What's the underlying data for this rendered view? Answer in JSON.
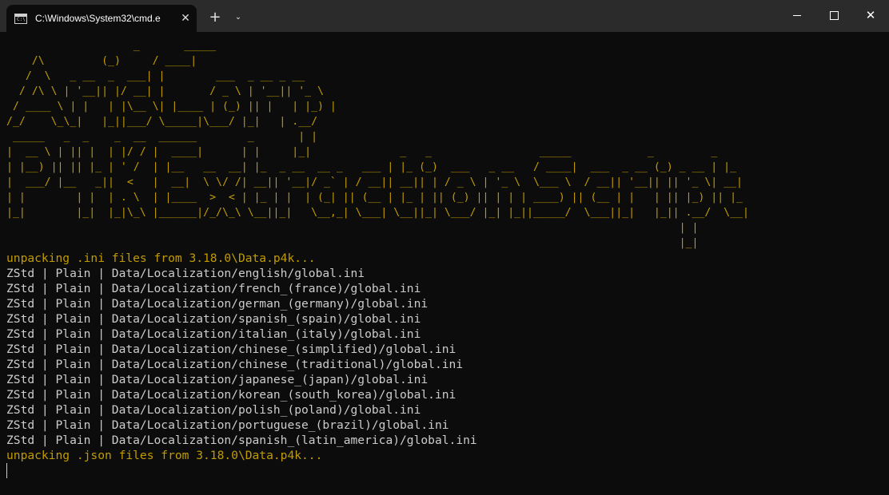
{
  "window": {
    "tab_title": "C:\\Windows\\System32\\cmd.e",
    "tab_icon_text": "C:\\",
    "tab_close": "✕",
    "new_tab": "+",
    "dropdown": "⌄",
    "close": "✕"
  },
  "terminal": {
    "ascii_art": "                    _       _____\n    /\\         (_)     / ____|\n   /  \\   _ __  _  ___| |        ___  _ __ _ __\n  / /\\ \\ | '__|| |/ __| |       / _ \\ | '__|| '_ \\\n / ____ \\ | |   | |\\__ \\| |____ | (_) || |   | |_) |\n/_/    \\_\\_|   |_||___/ \\_____|\\___/ |_|   | .__/\n _____   _  _    _  __  ______        _       | |                                                    \n|  __ \\ | || |  | |/ / |  ____|      | |     |_|              _   _                 _____            _         _\n| |__) || || |_ | ' /  | |__   __  __| |_  _ __  __ _   ___ | |_ (_)  ___   _ __   / ____|  ___  _ __ (_) _ __ | |_\n|  ___/ |__   _||  <   |  __|  \\ \\/ /| __|| '__|/ _` | / __|| __|| | / _ \\ | '_ \\  \\___ \\  / __|| '__|| || '_ \\| __|\n| |        | |  | . \\  | |____  >  < | |_ | |  | (_| || (__ | |_ | || (_) || | | | ____) || (__ | |   | || |_) || |_\n|_|        |_|  |_|\\_\\ |______|/_/\\_\\ \\__||_|   \\__,_| \\___| \\__||_| \\___/ |_| |_||_____/  \\___||_|   |_|| .__/  \\__|\n                                                                                                          | |\n                                                                                                          |_|",
    "status_start": "unpacking .ini files from 3.18.0\\Data.p4k...",
    "lines": [
      "ZStd | Plain | Data/Localization/english/global.ini",
      "ZStd | Plain | Data/Localization/french_(france)/global.ini",
      "ZStd | Plain | Data/Localization/german_(germany)/global.ini",
      "ZStd | Plain | Data/Localization/spanish_(spain)/global.ini",
      "ZStd | Plain | Data/Localization/italian_(italy)/global.ini",
      "ZStd | Plain | Data/Localization/chinese_(simplified)/global.ini",
      "ZStd | Plain | Data/Localization/chinese_(traditional)/global.ini",
      "ZStd | Plain | Data/Localization/japanese_(japan)/global.ini",
      "ZStd | Plain | Data/Localization/korean_(south_korea)/global.ini",
      "ZStd | Plain | Data/Localization/polish_(poland)/global.ini",
      "ZStd | Plain | Data/Localization/portuguese_(brazil)/global.ini",
      "ZStd | Plain | Data/Localization/spanish_(latin_america)/global.ini"
    ],
    "status_end": "unpacking .json files from 3.18.0\\Data.p4k..."
  }
}
